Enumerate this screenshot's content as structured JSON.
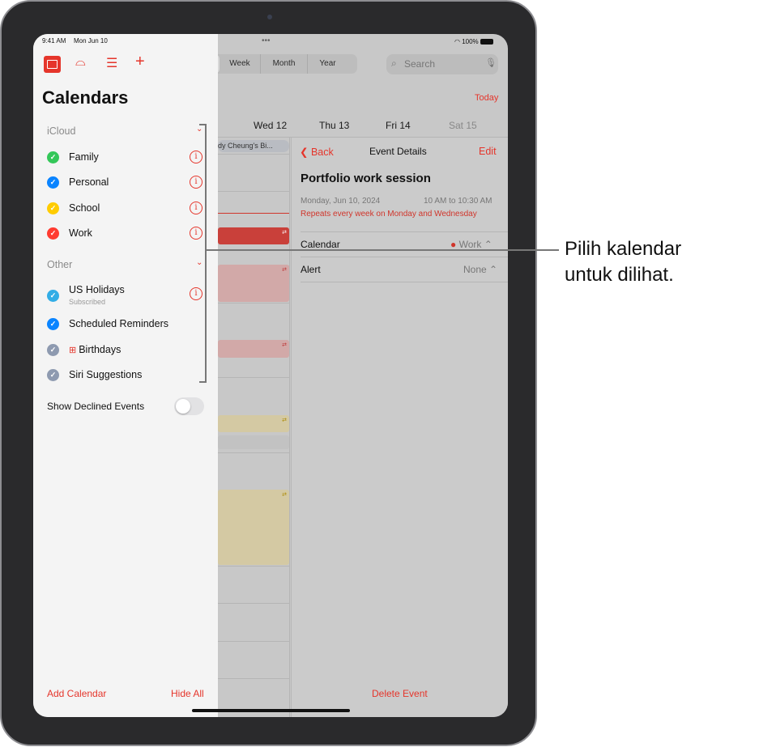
{
  "status_bar": {
    "time": "9:41 AM",
    "date": "Mon Jun 10",
    "battery": "100%",
    "dots": "•••"
  },
  "toolbar": {
    "segments": [
      "Week",
      "Month",
      "Year"
    ],
    "search_placeholder": "Search",
    "today": "Today"
  },
  "week": {
    "days": [
      "Wed 12",
      "Thu 13",
      "Fri 14",
      "Sat 15"
    ],
    "allday_event": "dy Cheung's Bi..."
  },
  "event_details": {
    "back": "Back",
    "title": "Event Details",
    "edit": "Edit",
    "event_name": "Portfolio work session",
    "date": "Monday, Jun 10, 2024",
    "time": "10 AM to 10:30 AM",
    "repeat": "Repeats every week on Monday and Wednesday",
    "calendar_label": "Calendar",
    "calendar_value": "Work",
    "alert_label": "Alert",
    "alert_value": "None",
    "delete": "Delete Event"
  },
  "sidebar": {
    "title": "Calendars",
    "icons": [
      "calendar-icon",
      "inbox-icon",
      "list-icon",
      "plus-icon"
    ],
    "sections": [
      {
        "name": "iCloud",
        "items": [
          {
            "label": "Family",
            "color": "#34c759"
          },
          {
            "label": "Personal",
            "color": "#0a84ff"
          },
          {
            "label": "School",
            "color": "#ffcc00"
          },
          {
            "label": "Work",
            "color": "#ff3b30"
          }
        ]
      },
      {
        "name": "Other",
        "items": [
          {
            "label": "US Holidays",
            "sub": "Subscribed",
            "color": "#32ade6"
          },
          {
            "label": "Scheduled Reminders",
            "color": "#0a84ff"
          },
          {
            "label": "Birthdays",
            "color": "#8e9ab0"
          },
          {
            "label": "Siri Suggestions",
            "color": "#8e9ab0"
          }
        ]
      }
    ],
    "show_declined": "Show Declined Events",
    "show_declined_on": false,
    "add_calendar": "Add Calendar",
    "hide_all": "Hide All"
  },
  "callout": {
    "line1": "Pilih kalendar",
    "line2": "untuk dilihat."
  },
  "colors": {
    "accent": "#e5352b"
  }
}
